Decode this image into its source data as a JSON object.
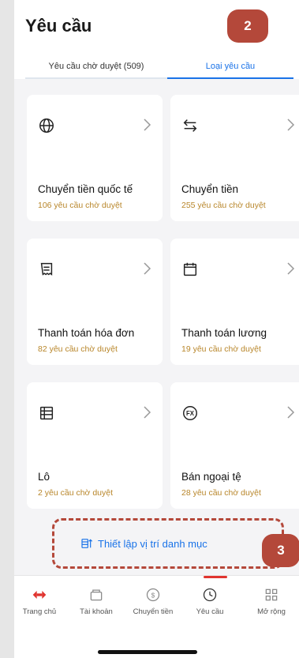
{
  "header": {
    "title": "Yêu cầu",
    "marker_top": "2",
    "marker_bottom": "3"
  },
  "tabs": [
    {
      "label": "Yêu cầu chờ duyệt (509)"
    },
    {
      "label": "Loại yêu cầu"
    }
  ],
  "cards": [
    {
      "title": "Chuyển tiền quốc tế",
      "sub": "106 yêu cầu chờ duyệt",
      "icon": "globe-icon"
    },
    {
      "title": "Chuyển tiền",
      "sub": "255 yêu cầu chờ duyệt",
      "icon": "transfer-arrows-icon"
    },
    {
      "title": "Thanh toán hóa đơn",
      "sub": "82 yêu cầu chờ duyệt",
      "icon": "receipt-icon"
    },
    {
      "title": "Thanh toán lương",
      "sub": "19 yêu cầu chờ duyệt",
      "icon": "calendar-icon"
    },
    {
      "title": "Lô",
      "sub": "2 yêu cầu chờ duyệt",
      "icon": "table-list-icon"
    },
    {
      "title": "Bán ngoại tệ",
      "sub": "28 yêu cầu chờ duyệt",
      "icon": "fx-icon"
    }
  ],
  "setup": {
    "label": "Thiết lập vị trí danh mục",
    "icon": "sort-order-icon"
  },
  "nav": [
    {
      "label": "Trang chủ",
      "icon": "home-logo-icon"
    },
    {
      "label": "Tài khoản",
      "icon": "wallet-icon"
    },
    {
      "label": "Chuyển tiền",
      "icon": "money-transfer-icon"
    },
    {
      "label": "Yêu cầu",
      "icon": "request-clock-icon"
    },
    {
      "label": "Mở rộng",
      "icon": "grid-more-icon"
    }
  ],
  "colors": {
    "accent": "#1a73e8",
    "brand_red": "#e0342f",
    "marker": "#b4483a",
    "subtitle": "#b8862a"
  }
}
